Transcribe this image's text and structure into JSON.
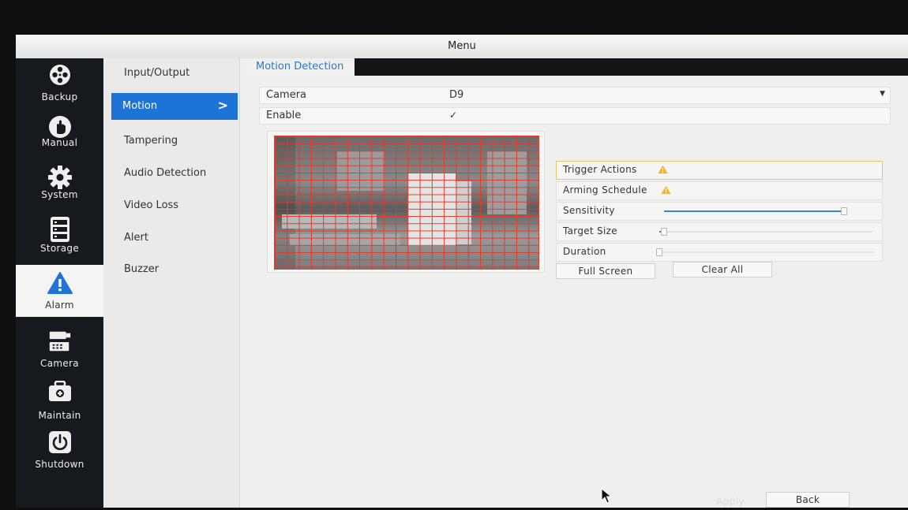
{
  "window": {
    "title": "Menu"
  },
  "nav": {
    "items": [
      {
        "label": "Backup",
        "icon": "film-reel-icon"
      },
      {
        "label": "Manual",
        "icon": "hand-icon"
      },
      {
        "label": "System",
        "icon": "gear-icon"
      },
      {
        "label": "Storage",
        "icon": "disk-icon"
      },
      {
        "label": "Alarm",
        "icon": "warning-icon"
      },
      {
        "label": "Camera",
        "icon": "camera-icon"
      },
      {
        "label": "Maintain",
        "icon": "toolbox-icon"
      },
      {
        "label": "Shutdown",
        "icon": "power-icon"
      }
    ],
    "active": "Alarm"
  },
  "submenu": {
    "items": [
      {
        "label": "Input/Output"
      },
      {
        "label": "Motion",
        "chevron": ">"
      },
      {
        "label": "Tampering"
      },
      {
        "label": "Audio Detection"
      },
      {
        "label": "Video Loss"
      },
      {
        "label": "Alert"
      },
      {
        "label": "Buzzer"
      }
    ],
    "active": "Motion"
  },
  "content": {
    "tab": "Motion Detection",
    "camera": {
      "label": "Camera",
      "value": "D9"
    },
    "enable": {
      "label": "Enable",
      "checked": true,
      "mark": "✓"
    },
    "trigger_actions": {
      "label": "Trigger Actions"
    },
    "arming_schedule": {
      "label": "Arming Schedule"
    },
    "sensitivity": {
      "label": "Sensitivity",
      "level": 0.98
    },
    "target_size": {
      "label": "Target Size",
      "level": 0.02
    },
    "duration": {
      "label": "Duration",
      "level": 0.0
    },
    "buttons": {
      "full_screen": "Full Screen",
      "clear_all": "Clear All",
      "apply": "Apply",
      "back": "Back"
    }
  },
  "colors": {
    "accent": "#1e73d6",
    "nav_bg": "#16191d",
    "grid": "#e23a2c",
    "warning": "#f0b22a"
  }
}
